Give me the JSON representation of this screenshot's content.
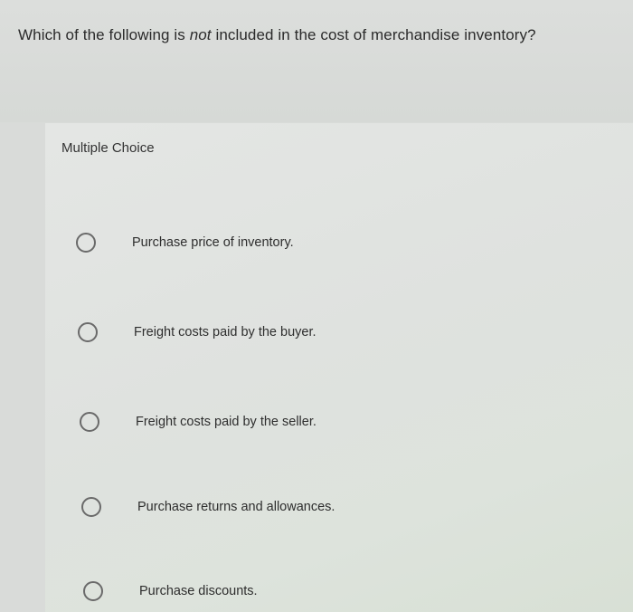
{
  "question": {
    "text_before": "Which of the following is ",
    "emphasis": "not",
    "text_after": " included in the cost of merchandise inventory?"
  },
  "choice_type_label": "Multiple Choice",
  "options": [
    {
      "label": "Purchase price of inventory."
    },
    {
      "label": "Freight costs paid by the buyer."
    },
    {
      "label": "Freight costs paid by the seller."
    },
    {
      "label": "Purchase returns and allowances."
    },
    {
      "label": "Purchase discounts."
    }
  ],
  "colors": {
    "background": "#d9dbd9",
    "panel": "#e2e4e2",
    "radio_border": "#6a6a6a",
    "text": "#2b2b2b"
  }
}
